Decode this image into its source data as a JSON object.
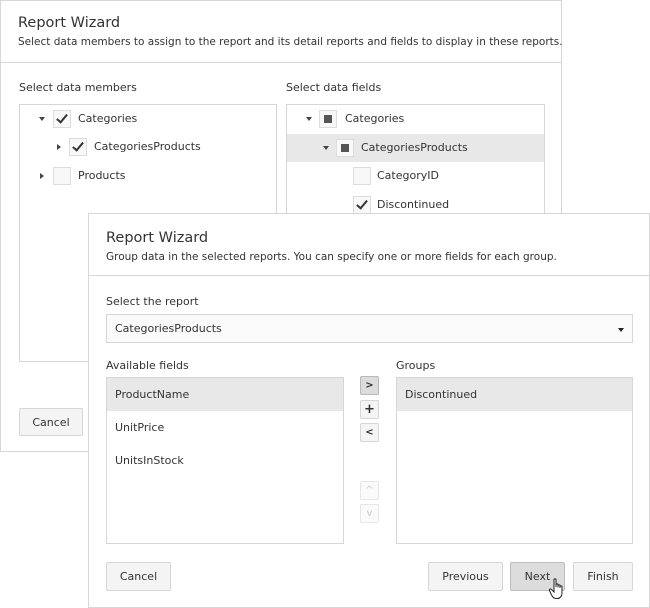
{
  "back_dialog": {
    "title": "Report Wizard",
    "subtitle": "Select data members to assign to the report and its detail reports and fields to display in these reports.",
    "members_label": "Select data members",
    "fields_label": "Select data fields",
    "members_tree": [
      {
        "label": "Categories",
        "expanded": true,
        "state": "checked",
        "level": 0
      },
      {
        "label": "CategoriesProducts",
        "expanded": false,
        "state": "checked",
        "level": 1
      },
      {
        "label": "Products",
        "expanded": false,
        "state": "unchecked",
        "level": 0
      }
    ],
    "fields_tree": [
      {
        "label": "Categories",
        "expanded": true,
        "state": "indeterminate",
        "level": 0
      },
      {
        "label": "CategoriesProducts",
        "expanded": true,
        "state": "indeterminate",
        "level": 1,
        "selected": true
      },
      {
        "label": "CategoryID",
        "state": "unchecked",
        "level": 2
      },
      {
        "label": "Discontinued",
        "state": "checked",
        "level": 2
      }
    ],
    "cancel_label": "Cancel"
  },
  "front_dialog": {
    "title": "Report Wizard",
    "subtitle": "Group data in the selected reports. You can specify one or more fields for each group.",
    "report_label": "Select the report",
    "report_value": "CategoriesProducts",
    "available_label": "Available fields",
    "available_fields": [
      {
        "label": "ProductName",
        "selected": true
      },
      {
        "label": "UnitPrice",
        "selected": false
      },
      {
        "label": "UnitsInStock",
        "selected": false
      }
    ],
    "groups_label": "Groups",
    "groups": [
      {
        "label": "Discontinued",
        "selected": true
      }
    ],
    "move_buttons": {
      "add": ">",
      "combine": "+",
      "remove": "<",
      "up": "^",
      "down": "v"
    },
    "cancel_label": "Cancel",
    "previous_label": "Previous",
    "next_label": "Next",
    "finish_label": "Finish"
  }
}
